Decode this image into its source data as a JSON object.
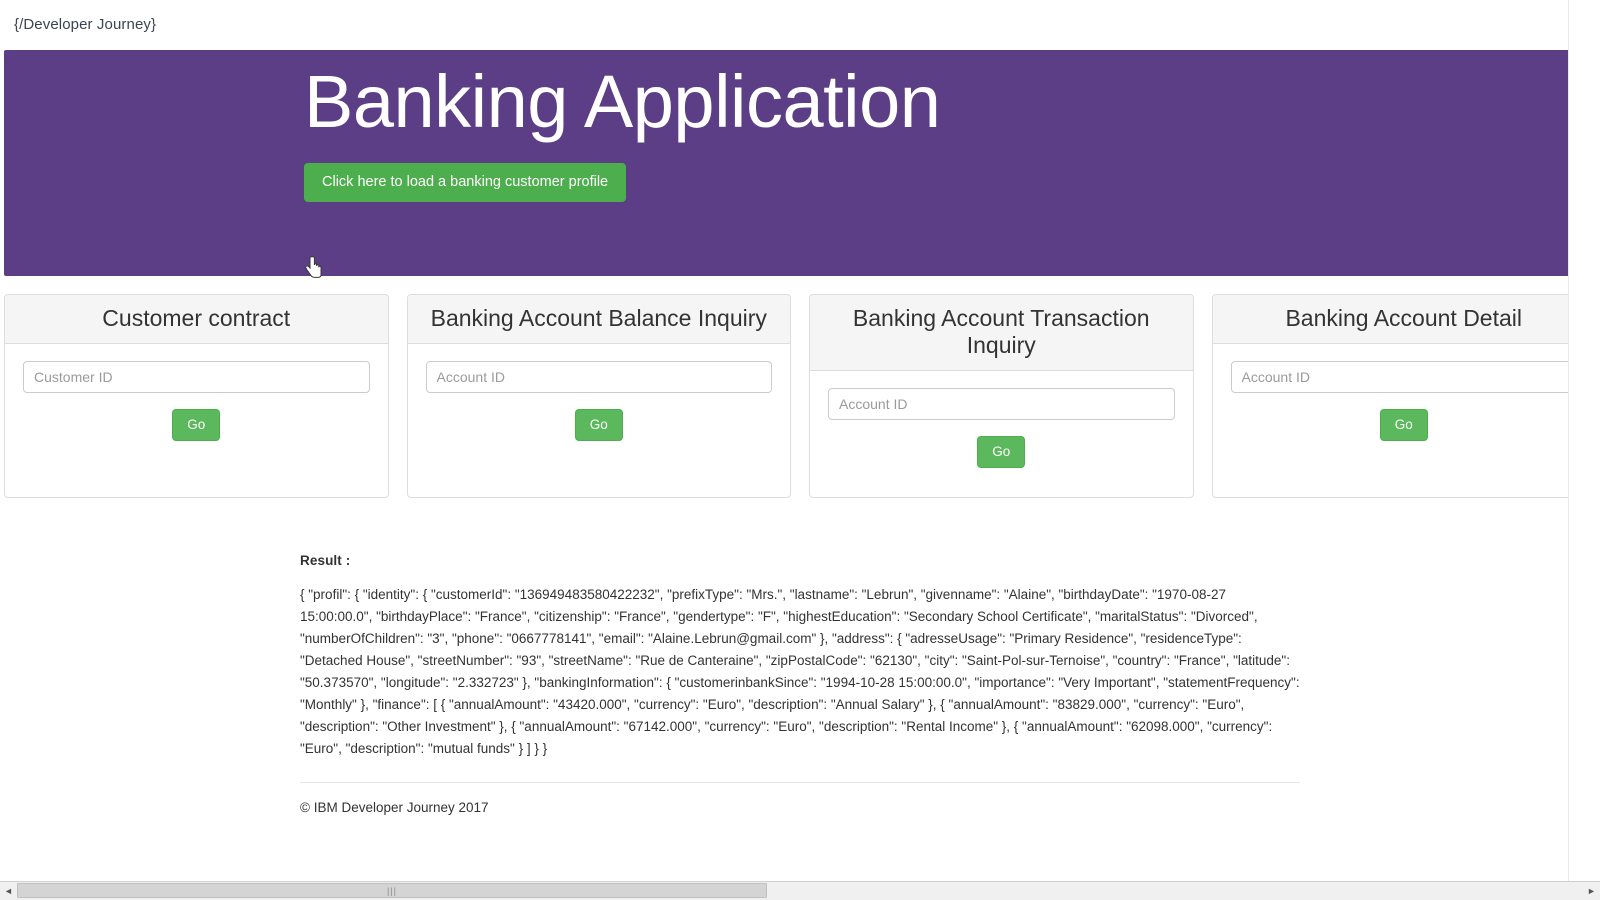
{
  "brand": {
    "text": "{/Developer Journey}"
  },
  "hero": {
    "title": "Banking Application",
    "load_button_label": "Click here to load a banking customer profile",
    "background_color": "#5b3e86",
    "button_color": "#4cae4c"
  },
  "panels": [
    {
      "title": "Customer contract",
      "input_placeholder": "Customer ID",
      "input_value": "",
      "button_label": "Go"
    },
    {
      "title": "Banking Account Balance Inquiry",
      "input_placeholder": "Account ID",
      "input_value": "",
      "button_label": "Go"
    },
    {
      "title": "Banking Account Transaction Inquiry",
      "input_placeholder": "Account ID",
      "input_value": "",
      "button_label": "Go"
    },
    {
      "title": "Banking Account Detail",
      "input_placeholder": "Account ID",
      "input_value": "",
      "button_label": "Go"
    }
  ],
  "result": {
    "label": "Result :",
    "body": "{ \"profil\": { \"identity\": { \"customerId\": \"136949483580422232\", \"prefixType\": \"Mrs.\", \"lastname\": \"Lebrun\", \"givenname\": \"Alaine\", \"birthdayDate\": \"1970-08-27 15:00:00.0\", \"birthdayPlace\": \"France\", \"citizenship\": \"France\", \"gendertype\": \"F\", \"highestEducation\": \"Secondary School Certificate\", \"maritalStatus\": \"Divorced\", \"numberOfChildren\": \"3\", \"phone\": \"0667778141\", \"email\": \"Alaine.Lebrun@gmail.com\" }, \"address\": { \"adresseUsage\": \"Primary Residence\", \"residenceType\": \"Detached House\", \"streetNumber\": \"93\", \"streetName\": \"Rue de Canteraine\", \"zipPostalCode\": \"62130\", \"city\": \"Saint-Pol-sur-Ternoise\", \"country\": \"France\", \"latitude\": \"50.373570\", \"longitude\": \"2.332723\" }, \"bankingInformation\": { \"customerinbankSince\": \"1994-10-28 15:00:00.0\", \"importance\": \"Very Important\", \"statementFrequency\": \"Monthly\" }, \"finance\": [ { \"annualAmount\": \"43420.000\", \"currency\": \"Euro\", \"description\": \"Annual Salary\" }, { \"annualAmount\": \"83829.000\", \"currency\": \"Euro\", \"description\": \"Other Investment\" }, { \"annualAmount\": \"67142.000\", \"currency\": \"Euro\", \"description\": \"Rental Income\" }, { \"annualAmount\": \"62098.000\", \"currency\": \"Euro\", \"description\": \"mutual funds\" } ] } }"
  },
  "footer": {
    "text": "© IBM Developer Journey 2017"
  },
  "scrollbar": {
    "left_arrow": "◄",
    "right_arrow": "►",
    "grip": "|||"
  }
}
